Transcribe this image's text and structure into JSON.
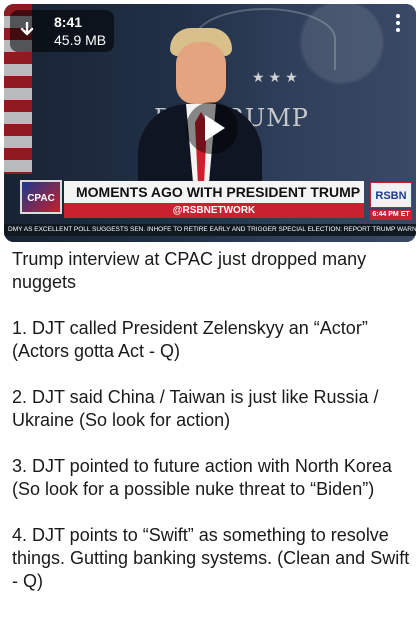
{
  "video": {
    "time": "8:41",
    "size": "45.9 MB",
    "download_icon": "download-arrow-icon",
    "menu_icon": "more-vertical-icon",
    "play_icon": "play-icon",
    "background_text": "D   J. TRUMP",
    "seal_stars": "★★★",
    "lower_third": {
      "logo": "CPAC",
      "headline": "MOMENTS AGO WITH PRESIDENT TRUMP",
      "handle": "@RSBNETWORK",
      "network": "RSBN",
      "clock": "6:44 PM ET"
    },
    "ticker": "DMY AS EXCELLENT POLL SUGGESTS    SEN. INHOFE TO RETIRE EARLY AND TRIGGER SPECIAL ELECTION: REPORT    TRUMP WARNED E"
  },
  "message": {
    "paragraphs": [
      "Trump interview at CPAC just dropped many nuggets",
      "1.  DJT called President Zelenskyy an “Actor” (Actors gotta Act - Q)",
      "2. DJT said China / Taiwan is just like Russia / Ukraine (So look for action)",
      "3. DJT pointed to future action with North Korea (So look for a possible nuke threat to “Biden”)",
      "4. DJT points to “Swift” as something to resolve things.  Gutting banking systems. (Clean and Swift - Q)"
    ]
  },
  "colors": {
    "accent_red": "#c9212f",
    "background": "#ffffff",
    "text": "#1a1a1a"
  }
}
